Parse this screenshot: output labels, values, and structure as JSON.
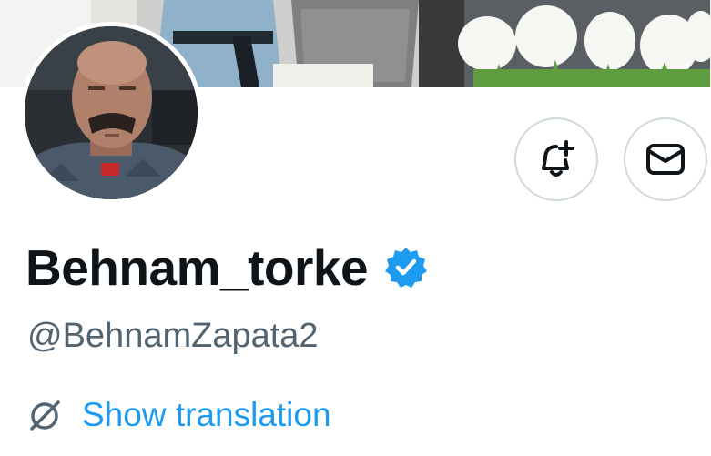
{
  "profile": {
    "display_name": "Behnam_torke",
    "handle": "@BehnamZapata2",
    "verified": true
  },
  "actions": {
    "notify_icon": "bell-plus-icon",
    "message_icon": "envelope-icon"
  },
  "translation": {
    "icon": "globe-icon",
    "link_label": "Show translation"
  },
  "colors": {
    "accent": "#1d9bf0",
    "secondary_text": "#536471",
    "button_border": "#cfd9de"
  }
}
